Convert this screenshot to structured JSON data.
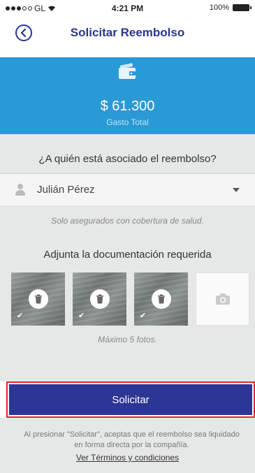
{
  "status_bar": {
    "carrier": "GL",
    "time": "4:21 PM",
    "battery": "100%"
  },
  "nav": {
    "title": "Solicitar Reembolso",
    "back_icon": "chevron-left-circle-icon"
  },
  "summary": {
    "icon": "wallet-icon",
    "amount": "$ 61.300",
    "label": "Gasto Total",
    "color": "#2a9ad6"
  },
  "form": {
    "question": "¿A quién está asociado el reembolso?",
    "selected_person": "Julián Pérez",
    "note": "Solo asegurados con cobertura de salud.",
    "attach_title": "Adjunta la documentación requerida",
    "photos": [
      {
        "icon": "trash-icon"
      },
      {
        "icon": "trash-icon"
      },
      {
        "icon": "trash-icon"
      }
    ],
    "add_photo_icon": "camera-icon",
    "max_note": "Máximo 5 fotos."
  },
  "submit": {
    "label": "Solicitar",
    "color": "#2c3694"
  },
  "footer": {
    "text": "Al presionar \"Solicitar\", aceptas que el reembolso sea liquidado en forma directa por la compañía.",
    "terms_link": "Ver Términos y condiciones"
  }
}
